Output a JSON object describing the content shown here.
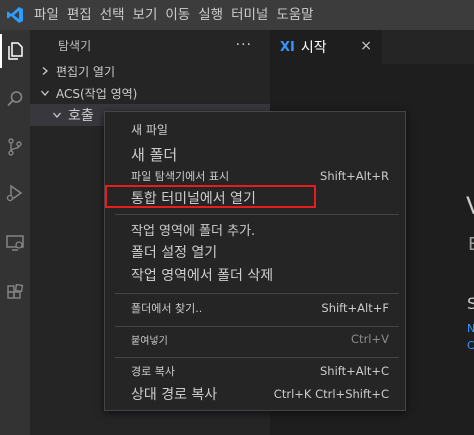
{
  "menubar": {
    "items": [
      "파일",
      "편집",
      "선택",
      "보기",
      "이동",
      "실행",
      "터미널",
      "도움말"
    ]
  },
  "activity_bar": {
    "icons": [
      "files-icon",
      "search-icon",
      "source-control-icon",
      "run-debug-icon",
      "remote-explorer-icon",
      "extensions-icon"
    ]
  },
  "sidebar": {
    "title": "탐색기",
    "more": "···",
    "open_editors": "편집기 열기",
    "workspace": "ACS(작업 영역)",
    "folder": "호출"
  },
  "editor": {
    "tab_icon": "XI",
    "tab_label": "시작",
    "tab_close": "×",
    "welcome_partial": [
      "V",
      "E",
      "S",
      "N",
      "C"
    ]
  },
  "context_menu": {
    "items": [
      {
        "label": "새 파일",
        "shortcut": ""
      },
      {
        "label": "새 폴더",
        "shortcut": ""
      },
      {
        "label": "파일 탐색기에서 표시",
        "shortcut": "Shift+Alt+R"
      },
      {
        "label": "통합 터미널에서 열기",
        "shortcut": ""
      },
      {
        "label": "작업 영역에 폴더 추가.",
        "shortcut": ""
      },
      {
        "label": "폴더 설정 열기",
        "shortcut": ""
      },
      {
        "label": "작업 영역에서 폴더 삭제",
        "shortcut": ""
      },
      {
        "label": "폴더에서 찾기..",
        "shortcut": "Shift+Alt+F"
      },
      {
        "label": "붙여넣기",
        "shortcut": "Ctrl+V"
      },
      {
        "label": "경로 복사",
        "shortcut": "Shift+Alt+C"
      },
      {
        "label": "상대 경로 복사",
        "shortcut": "Ctrl+K Ctrl+Shift+C"
      }
    ]
  },
  "colors": {
    "accent_blue": "#3794ff",
    "highlight_red": "#e51d1d",
    "menu_bg": "#252526",
    "activity_bg": "#333333",
    "titlebar_bg": "#3c3c3c"
  }
}
